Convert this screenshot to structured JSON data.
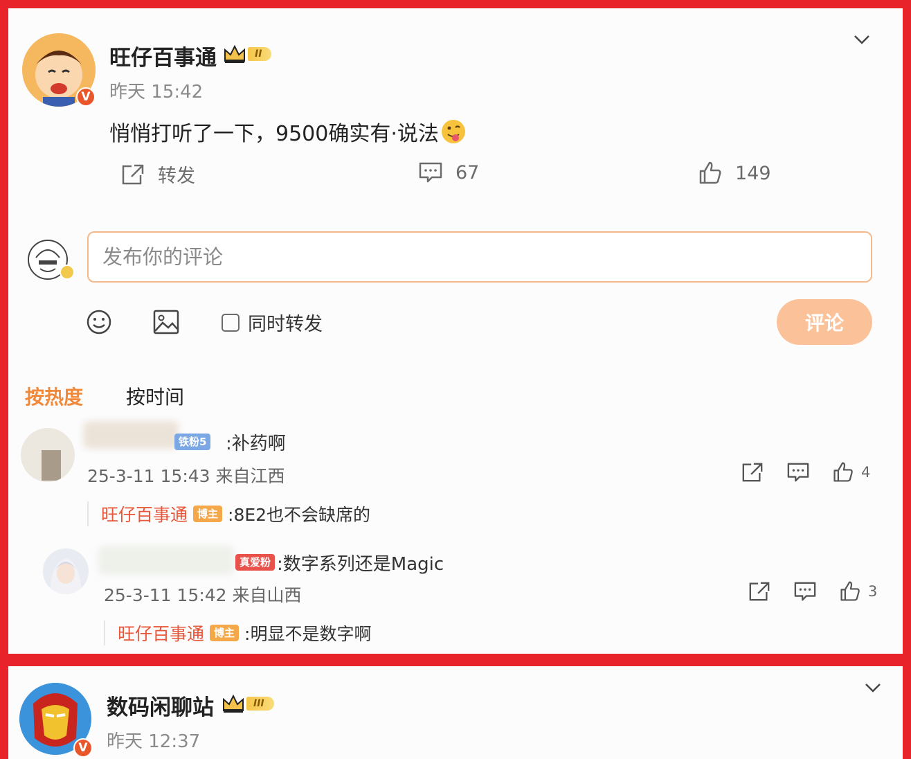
{
  "post1": {
    "author": "旺仔百事通",
    "level_badge": "II",
    "verified_mark": "V",
    "time": "昨天 15:42",
    "text": "悄悄打听了一下，9500确实有·说法",
    "actions": {
      "repost_label": "转发",
      "comment_count": "67",
      "like_count": "149"
    }
  },
  "composer": {
    "placeholder": "发布你的评论",
    "repost_checkbox_label": "同时转发",
    "submit_label": "评论"
  },
  "sort_tabs": {
    "hot": "按热度",
    "time": "按时间"
  },
  "comments": [
    {
      "fan_tag": "铁粉5",
      "text": ":补药啊",
      "meta": "25-3-11 15:43 来自江西",
      "like_count": "4",
      "reply": {
        "author": "旺仔百事通",
        "tag": "博主",
        "text": ":8E2也不会缺席的"
      }
    },
    {
      "fan_tag": "真爱粉",
      "text": ":数字系列还是Magic",
      "meta": "25-3-11 15:42 来自山西",
      "like_count": "3",
      "reply": {
        "author": "旺仔百事通",
        "tag": "博主",
        "text": ":明显不是数字啊"
      }
    }
  ],
  "post2": {
    "author": "数码闲聊站",
    "level_badge": "III",
    "verified_mark": "V",
    "time": "昨天 12:37"
  },
  "colors": {
    "accent_orange": "#f08a3a",
    "frame_red": "#e8232a",
    "reply_name": "#e8563a"
  },
  "icons": [
    "chevron-down-icon",
    "crown-icon",
    "repost-icon",
    "comment-icon",
    "like-icon",
    "emoji-icon",
    "image-icon"
  ]
}
